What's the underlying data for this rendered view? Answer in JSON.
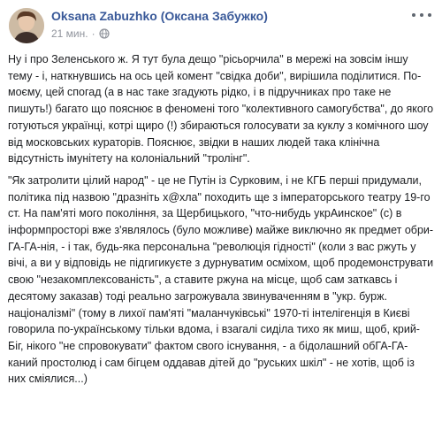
{
  "author": {
    "name": "Oksana Zabuzhko (Оксана Забужко)"
  },
  "post_meta": {
    "time": "21 мин.",
    "separator": "·",
    "audience_icon": "globe-icon"
  },
  "menu": {
    "icon": "more-options-icon"
  },
  "post": {
    "paragraphs": [
      "Ну і про Зеленського ж. Я тут була дещо \"рісьорчила\" в мережі на зовсім іншу тему - і, наткнувшись на ось цей комент \"свідка доби\", вирішила поділитися. По-моєму, цей спогад (а в нас таке згадують рідко, і в підручниках про таке не пишуть!) багато що пояснює в феномені того \"колективного самогубства\", до якого готуються українці, котрі щиро (!) збираються голосувати за куклу з комічного шоу від московських кураторів. Пояснює, звідки в наших людей така клінічна відсутність імунітету на колоніальний \"тролінг\".",
      "\"Як затролити цілий народ\" - це не Путін із Сурковим, і не КГБ перші придумали, політика під назвою \"дразніть х@хла\" походить ще з імператорського театру 19-го ст. На пам'яті мого покоління, за Щербицького, \"что-нибудь укрАинское\" (с) в інформпросторі вже з'являлось (було можливе) майже виключно як предмет обри-ГА-ГА-нія, - і так, будь-яка персональна \"революція гідності\" (коли з вас ржуть у вічі, а ви у відповідь не підгигикуєте з дурнуватим осміхом, щоб продемонструвати свою \"незакомплексованість\", а ставите ржуна на місце, щоб сам заткавсь і десятому заказав) тоді реально загрожувала звинуваченням в \"укр. бурж. націоналізмі\" (тому в лихої пам'яті \"маланчуківські\" 1970-ті інтелігенція в Києві говорила по-українському тільки вдома, і взагалі сиділа тихо як миш, щоб, крий-Біг, нікого \"не спровокувати\" фактом свого існування, - а бідолашний обГА-ГА-каний простолюд і сам бігцем оддавав дітей до \"руських шкіл\" - не хотів, щоб із них сміялися...)"
    ]
  },
  "colors": {
    "author_link": "#385898",
    "meta_text": "#90949c",
    "body_text": "#1c1e21"
  }
}
